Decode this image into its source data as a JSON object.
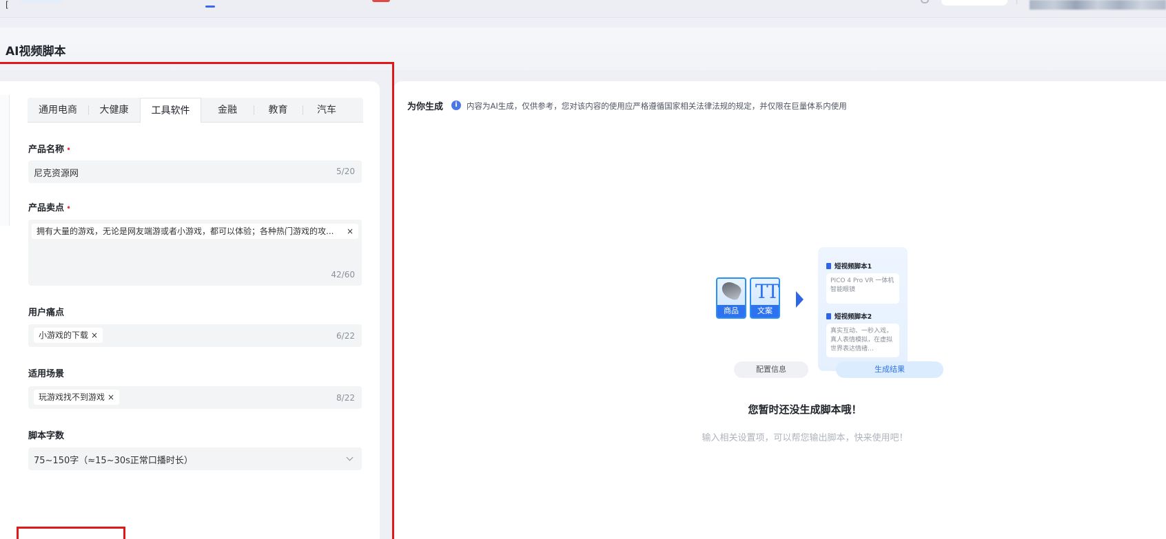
{
  "topbar": {
    "bracket_glyph": "["
  },
  "page": {
    "title": "AI视频脚本"
  },
  "tabs": [
    {
      "label": "通用电商",
      "active": false
    },
    {
      "label": "大健康",
      "active": false
    },
    {
      "label": "工具软件",
      "active": true
    },
    {
      "label": "金融",
      "active": false
    },
    {
      "label": "教育",
      "active": false
    },
    {
      "label": "汽车",
      "active": false
    }
  ],
  "form": {
    "product_name": {
      "label": "产品名称",
      "required_mark": "•",
      "value": "尼克资源网",
      "counter": "5/20"
    },
    "selling_points": {
      "label": "产品卖点",
      "required_mark": "•",
      "tag": "拥有大量的游戏，无论是网友端游或者小游戏，都可以体验；各种热门游戏的攻...",
      "counter": "42/60"
    },
    "pain_points": {
      "label": "用户痛点",
      "tag": "小游戏的下载",
      "counter": "6/22"
    },
    "scenarios": {
      "label": "适用场景",
      "tag": "玩游戏找不到游戏",
      "counter": "8/22"
    },
    "word_count": {
      "label": "脚本字数",
      "value": "75~150字（≈15~30s正常口播时长）"
    },
    "tag_close": "×"
  },
  "result": {
    "title": "为你生成",
    "info_glyph": "i",
    "note": "内容为AI生成，仅供参考，您对该内容的使用应严格遵循国家相关法律法规的规定，并仅限在巨量体系内使用",
    "illustration": {
      "card1_label": "商品",
      "card2_label": "文案",
      "card2_glyph": "TT",
      "script1_title": "短视频脚本1",
      "script1_text": "PICO 4 Pro VR 一体机智能眼镜",
      "script2_title": "短视频脚本2",
      "script2_text": "真实互动、一秒入戏，真人表情模拟，在虚拟世界表达情绪…",
      "pill_config": "配置信息",
      "pill_result": "生成结果"
    },
    "empty_title": "您暂时还没生成脚本哦！",
    "empty_desc": "输入相关设置项，可以帮您输出脚本，快来使用吧！"
  },
  "colors": {
    "accent": "#2d72f0",
    "highlight_border": "#e01818",
    "required": "#e03a3a"
  }
}
